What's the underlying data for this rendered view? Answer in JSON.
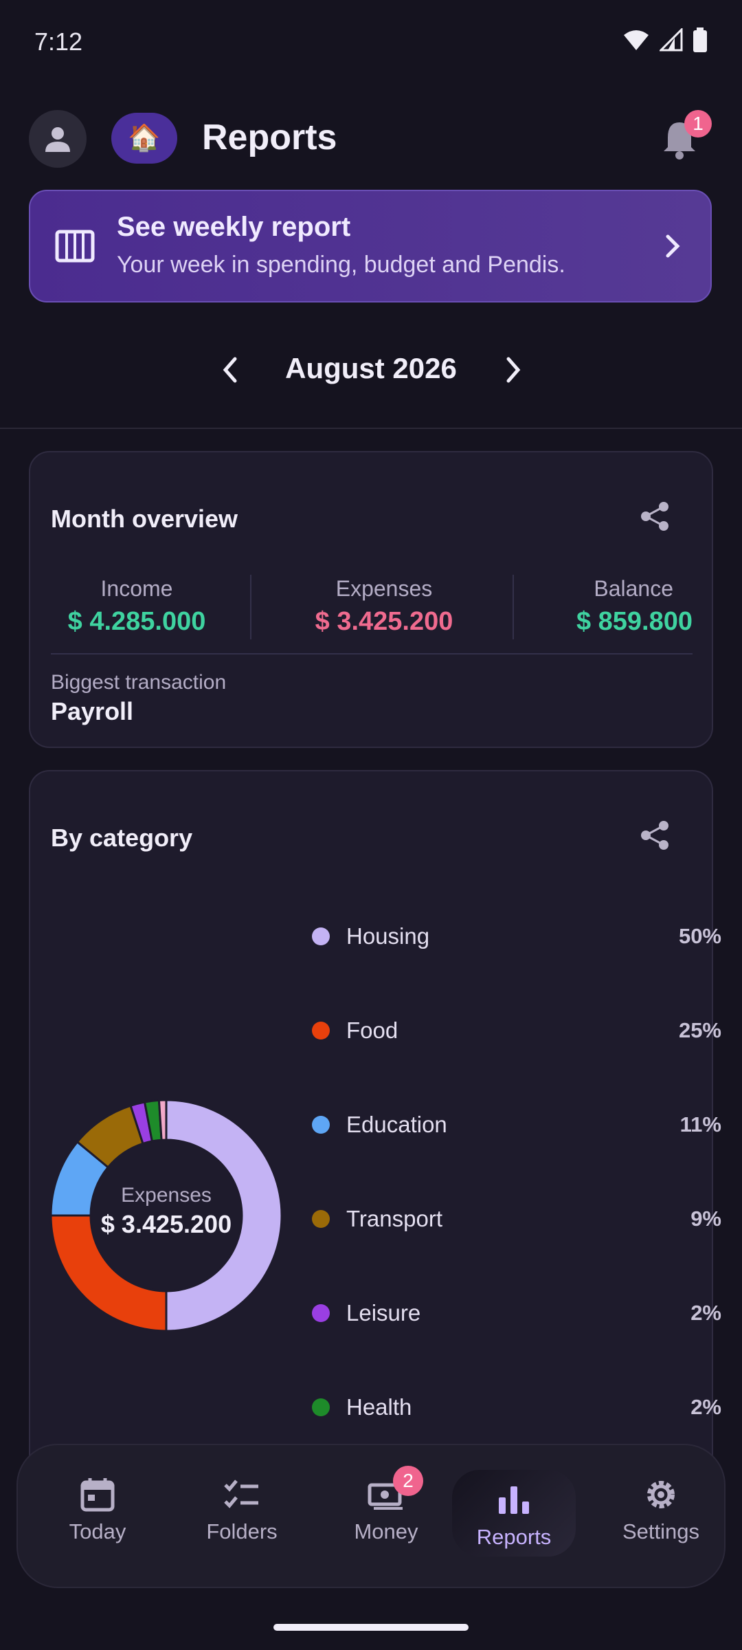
{
  "status_bar": {
    "time": "7:12"
  },
  "header": {
    "title": "Reports",
    "notification_count": "1",
    "home_emoji": "🏠"
  },
  "banner": {
    "title": "See weekly report",
    "subtitle": "Your week in spending, budget and Pendis."
  },
  "month_nav": {
    "label": "August 2026"
  },
  "overview": {
    "title": "Month overview",
    "income": {
      "label": "Income",
      "value": "$ 4.285.000",
      "color": "#3fd3a0"
    },
    "expenses": {
      "label": "Expenses",
      "value": "$ 3.425.200",
      "color": "#f06b8f"
    },
    "balance": {
      "label": "Balance",
      "value": "$ 859.800",
      "color": "#3fd3a0"
    },
    "biggest_label": "Biggest transaction",
    "biggest_value": "Payroll"
  },
  "category": {
    "title": "By category",
    "center_label": "Expenses",
    "center_value": "$ 3.425.200",
    "items": [
      {
        "label": "Housing",
        "pct": "50%",
        "color": "#c4b3f4"
      },
      {
        "label": "Food",
        "pct": "25%",
        "color": "#e8400c"
      },
      {
        "label": "Education",
        "pct": "11%",
        "color": "#5ea6f5"
      },
      {
        "label": "Transport",
        "pct": "9%",
        "color": "#9a6a08"
      },
      {
        "label": "Leisure",
        "pct": "2%",
        "color": "#9a3fe3"
      },
      {
        "label": "Health",
        "pct": "2%",
        "color": "#1e8b2a"
      }
    ],
    "extra_slice": {
      "label": "",
      "pct": "1%",
      "color": "#f2a9c9"
    }
  },
  "bottom_nav": {
    "items": [
      {
        "label": "Today",
        "icon": "calendar-icon"
      },
      {
        "label": "Folders",
        "icon": "checklist-icon"
      },
      {
        "label": "Money",
        "icon": "money-icon",
        "badge": "2"
      },
      {
        "label": "Reports",
        "icon": "bar-chart-icon"
      },
      {
        "label": "Settings",
        "icon": "gear-icon"
      }
    ]
  }
}
